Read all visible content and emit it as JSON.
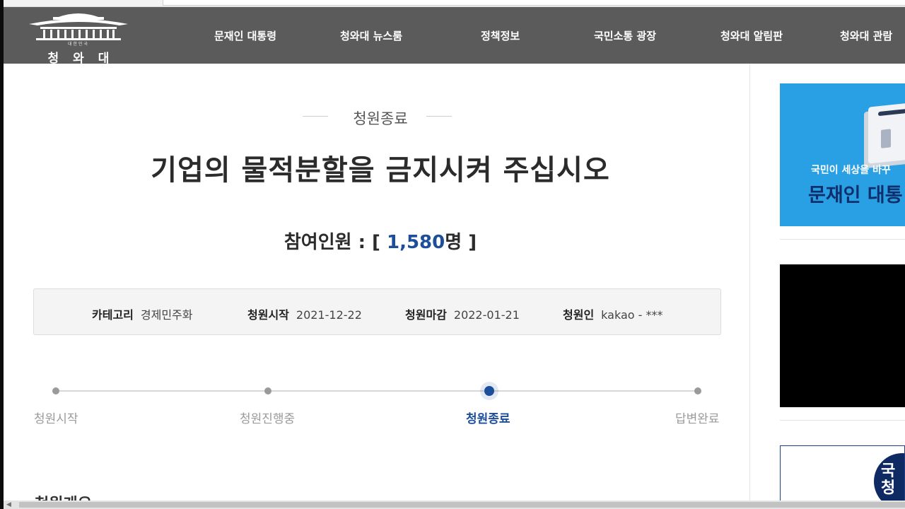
{
  "header": {
    "logo_small": "대한민국",
    "logo_text": "청와대",
    "nav": [
      {
        "label": "문재인 대통령"
      },
      {
        "label": "청와대 뉴스룸"
      },
      {
        "label": "정책정보"
      },
      {
        "label": "국민소통 광장"
      },
      {
        "label": "청와대 알림판"
      },
      {
        "label": "청와대 관람"
      }
    ]
  },
  "petition": {
    "status": "청원종료",
    "title": "기업의 물적분할을 금지시켜 주십시오",
    "count_prefix": "참여인원 : [ ",
    "count_value": "1,580",
    "count_suffix": "명 ]",
    "info": [
      {
        "key": "카테고리",
        "value": "경제민주화"
      },
      {
        "key": "청원시작",
        "value": "2021-12-22"
      },
      {
        "key": "청원마감",
        "value": "2022-01-21"
      },
      {
        "key": "청원인",
        "value": "kakao - ***"
      }
    ],
    "steps": [
      {
        "label": "청원시작",
        "active": false
      },
      {
        "label": "청원진행중",
        "active": false
      },
      {
        "label": "청원종료",
        "active": true
      },
      {
        "label": "답변완료",
        "active": false
      }
    ],
    "section_peek": "청원개요"
  },
  "sidebar": {
    "banner1_line1": "국민이 세상을 바꾸",
    "banner1_line2": "문재인 대통",
    "banner3_text": "국\n청"
  },
  "colors": {
    "header_bg": "#5b5b5b",
    "accent": "#1c4e9a",
    "banner_blue": "#29a0e4"
  }
}
